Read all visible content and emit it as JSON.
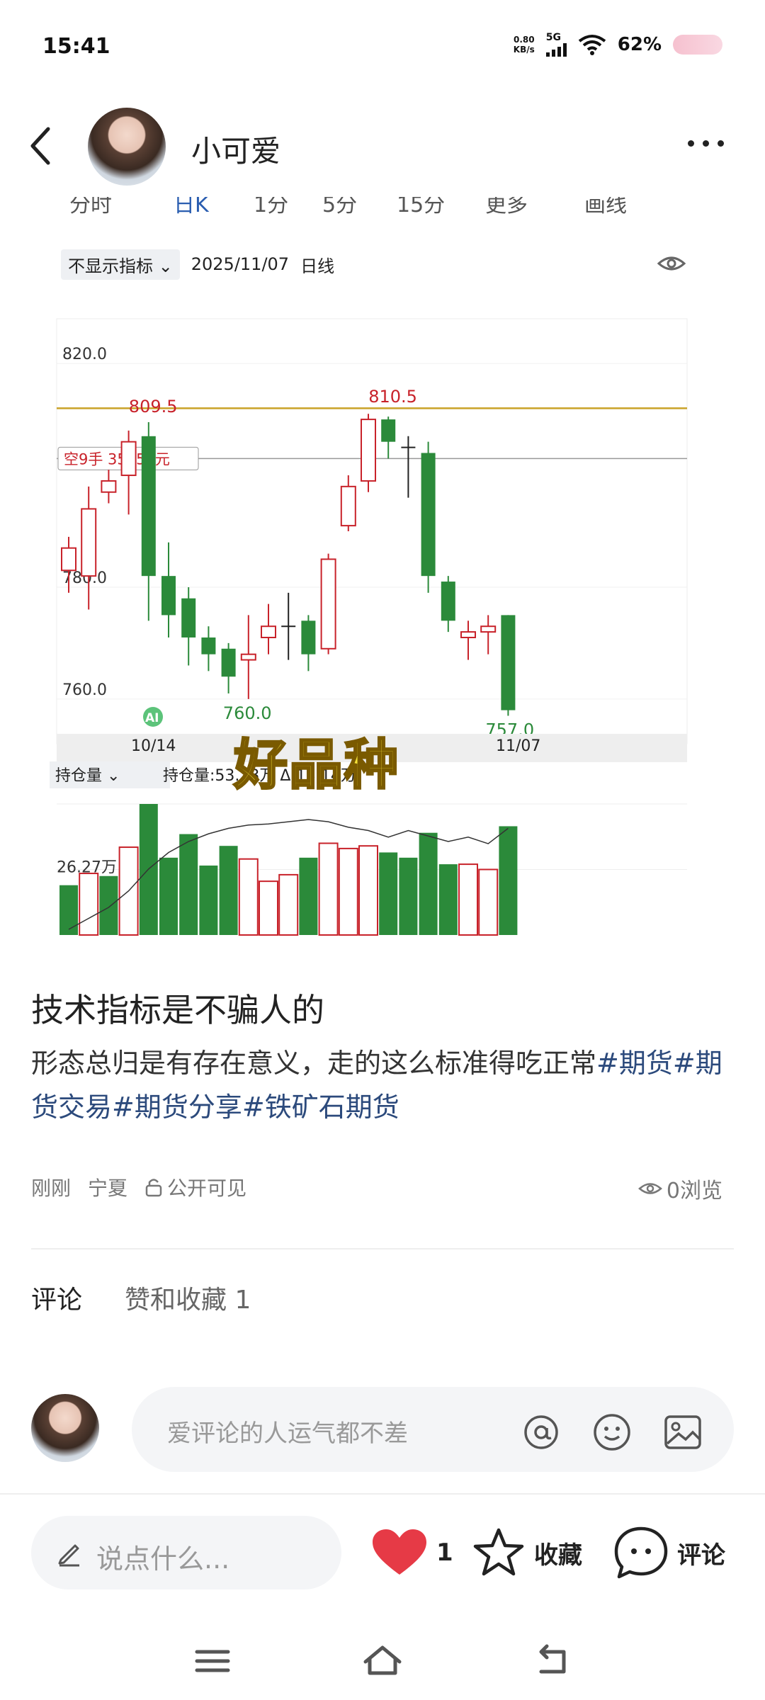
{
  "status_bar": {
    "time": "15:41",
    "net_speed_value": "0.80",
    "net_speed_unit": "KB/s",
    "network": "5G",
    "battery": "62%"
  },
  "header": {
    "username": "小可爱"
  },
  "chart_tabs": [
    "分时",
    "日K",
    "1分",
    "5分",
    "15分",
    "更多",
    "画线"
  ],
  "chart_toolbar": {
    "indicator": "不显示指标",
    "date": "2025/11/07",
    "period": "日线"
  },
  "chart_data": {
    "type": "candlestick",
    "dates_shown": [
      "10/14",
      "11/07"
    ],
    "y_ticks": [
      820.0,
      780.0,
      760.0
    ],
    "ylim": [
      752,
      828
    ],
    "candles": [
      {
        "o": 783,
        "c": 787,
        "h": 789,
        "l": 779
      },
      {
        "o": 782,
        "c": 794,
        "h": 798,
        "l": 776
      },
      {
        "o": 797,
        "c": 799,
        "h": 801,
        "l": 795
      },
      {
        "o": 800,
        "c": 806,
        "h": 808,
        "l": 793
      },
      {
        "o": 807,
        "c": 782,
        "h": 809.5,
        "l": 774
      },
      {
        "o": 782,
        "c": 775,
        "h": 788,
        "l": 771
      },
      {
        "o": 778,
        "c": 771,
        "h": 780,
        "l": 766
      },
      {
        "o": 771,
        "c": 768,
        "h": 773,
        "l": 765
      },
      {
        "o": 769,
        "c": 764,
        "h": 770,
        "l": 761
      },
      {
        "o": 767,
        "c": 768,
        "h": 775,
        "l": 760
      },
      {
        "o": 771,
        "c": 773,
        "h": 777,
        "l": 768
      },
      {
        "o": 773,
        "c": 773,
        "h": 779,
        "l": 767
      },
      {
        "o": 774,
        "c": 768,
        "h": 775,
        "l": 765
      },
      {
        "o": 769,
        "c": 785,
        "h": 786,
        "l": 768
      },
      {
        "o": 791,
        "c": 798,
        "h": 800,
        "l": 790
      },
      {
        "o": 799,
        "c": 810,
        "h": 811,
        "l": 797
      },
      {
        "o": 810,
        "c": 806,
        "h": 810.5,
        "l": 803
      },
      {
        "o": 805,
        "c": 805,
        "h": 807,
        "l": 796
      },
      {
        "o": 804,
        "c": 782,
        "h": 806,
        "l": 779
      },
      {
        "o": 781,
        "c": 774,
        "h": 782,
        "l": 772
      },
      {
        "o": 771,
        "c": 772,
        "h": 774,
        "l": 767
      },
      {
        "o": 772,
        "c": 773,
        "h": 775,
        "l": 768
      },
      {
        "o": 775,
        "c": 758,
        "h": 775,
        "l": 757
      }
    ],
    "annotations": {
      "high_left": "809.5",
      "high_right": "810.5",
      "low_left": "760.0",
      "low_right": "757.0"
    },
    "resistance_line": 812,
    "position_line": 803,
    "position_label": "空9手 35550元",
    "volume_indicator": "持仓量",
    "volume_label": "持仓量:53.73万 Δ:13.14万",
    "volume_tick": "26.27万",
    "volume_bars": [
      {
        "v": 0.38,
        "up": false
      },
      {
        "v": 0.47,
        "up": true
      },
      {
        "v": 0.45,
        "up": false
      },
      {
        "v": 0.67,
        "up": true
      },
      {
        "v": 1.0,
        "up": false
      },
      {
        "v": 0.59,
        "up": false
      },
      {
        "v": 0.77,
        "up": false
      },
      {
        "v": 0.53,
        "up": false
      },
      {
        "v": 0.68,
        "up": false
      },
      {
        "v": 0.58,
        "up": true
      },
      {
        "v": 0.41,
        "up": true
      },
      {
        "v": 0.46,
        "up": true
      },
      {
        "v": 0.59,
        "up": false
      },
      {
        "v": 0.7,
        "up": true
      },
      {
        "v": 0.66,
        "up": true
      },
      {
        "v": 0.68,
        "up": true
      },
      {
        "v": 0.63,
        "up": false
      },
      {
        "v": 0.59,
        "up": false
      },
      {
        "v": 0.78,
        "up": false
      },
      {
        "v": 0.54,
        "up": false
      },
      {
        "v": 0.54,
        "up": true
      },
      {
        "v": 0.5,
        "up": true
      },
      {
        "v": 0.83,
        "up": false
      }
    ],
    "oi_line": [
      0.0,
      0.1,
      0.2,
      0.35,
      0.55,
      0.7,
      0.8,
      0.87,
      0.92,
      0.95,
      0.96,
      0.98,
      1.0,
      0.98,
      0.93,
      0.9,
      0.84,
      0.9,
      0.85,
      0.8,
      0.84,
      0.78,
      0.92
    ]
  },
  "overlay_text": "好品种",
  "ai_badge": "AI",
  "post": {
    "title": "技术指标是不骗人的",
    "body": "形态总归是有存在意义，走的这么标准得吃正常",
    "tags": [
      "#期货",
      "#期货交易",
      "#期货分享",
      "#铁矿石期货"
    ],
    "time": "刚刚",
    "location": "宁夏",
    "visibility": "公开可见",
    "views": "0浏览"
  },
  "comments": {
    "tab_comments": "评论",
    "tab_likes": "赞和收藏 1",
    "input_placeholder": "爱评论的人运气都不差"
  },
  "bottom_bar": {
    "say_placeholder": "说点什么...",
    "like_count": "1",
    "favorite_label": "收藏",
    "comment_label": "评论"
  },
  "colors": {
    "up": "#c8222a",
    "down": "#2b8a3a",
    "accent": "#e63a46",
    "tag": "#2c4a7c",
    "line": "#c9a227"
  }
}
